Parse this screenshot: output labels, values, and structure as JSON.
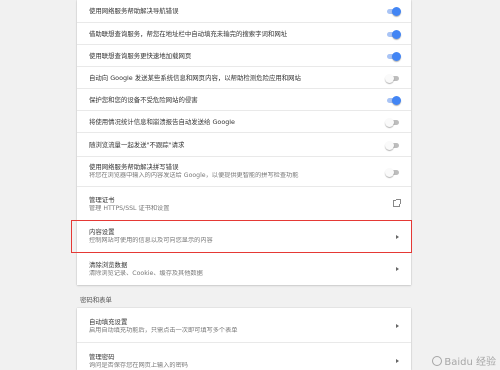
{
  "privacy_rows": [
    {
      "title": "使用网络服务帮助解决导航错误",
      "toggle": "on"
    },
    {
      "title": "借助联想查询服务，帮您在地址栏中自动填充未输完的搜索字词和网址",
      "toggle": "on"
    },
    {
      "title": "使用联想查询服务更快速地加载网页",
      "toggle": "on"
    },
    {
      "title": "自动向 Google 发送某些系统信息和网页内容，以帮助检测危险应用和网站",
      "toggle": "off"
    },
    {
      "title": "保护您和您的设备不受危险网站的侵害",
      "toggle": "on"
    },
    {
      "title": "将使用情况统计信息和崩溃报告自动发送给 Google",
      "toggle": "off"
    },
    {
      "title": "随浏览流量一起发送\"不跟踪\"请求",
      "toggle": "off"
    },
    {
      "title": "使用网络服务帮助解决拼写错误",
      "subtitle": "将您在浏览器中输入的内容发送给 Google，以便提供更智能的拼写检查功能",
      "toggle": "off"
    }
  ],
  "certificates": {
    "title": "管理证书",
    "subtitle": "管理 HTTPS/SSL 证书和设置",
    "icon": "open-in-new-icon"
  },
  "content_settings": {
    "title": "内容设置",
    "subtitle": "控制网站可使用的信息以及可向您显示的内容",
    "icon": "chevron-right-icon"
  },
  "clear_data": {
    "title": "清除浏览数据",
    "subtitle": "清除浏览记录、Cookie、缓存及其他数据",
    "icon": "chevron-right-icon"
  },
  "section_passwords": {
    "heading": "密码和表单"
  },
  "autofill": {
    "title": "自动填充设置",
    "subtitle": "启用自动填充功能后，只需点击一次即可填写多个表单"
  },
  "passwords": {
    "title": "管理密码",
    "subtitle": "询问是否保存您在网页上输入的密码"
  },
  "watermark": "Baidu 经验",
  "colors": {
    "toggle_on": "#4285f4",
    "highlight": "#e53935",
    "background": "#f1f1f1"
  }
}
